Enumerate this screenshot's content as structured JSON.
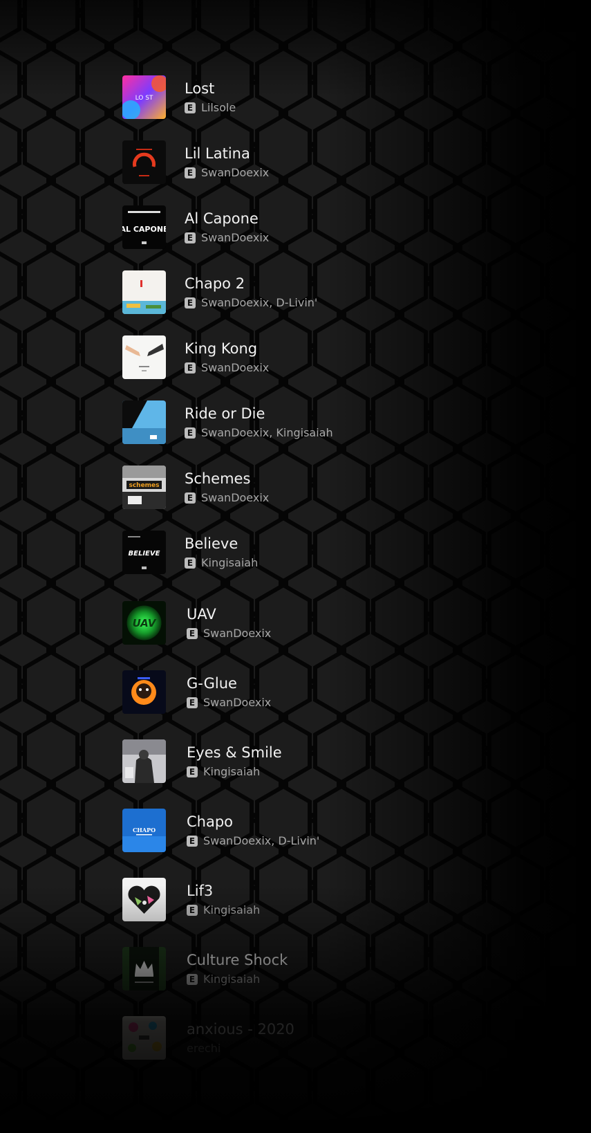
{
  "tracks": [
    {
      "title": "Lost",
      "explicit_label": "E",
      "artist": "Lilsole",
      "art_icon": "lost-album-art"
    },
    {
      "title": "Lil Latina",
      "explicit_label": "E",
      "artist": "SwanDoexix",
      "art_icon": "lil-latina-album-art"
    },
    {
      "title": "Al Capone",
      "explicit_label": "E",
      "artist": "SwanDoexix",
      "art_icon": "al-capone-album-art"
    },
    {
      "title": "Chapo 2",
      "explicit_label": "E",
      "artist": "SwanDoexix, D-Livin'",
      "art_icon": "chapo-2-album-art"
    },
    {
      "title": "King Kong",
      "explicit_label": "E",
      "artist": "SwanDoexix",
      "art_icon": "king-kong-album-art"
    },
    {
      "title": "Ride or Die",
      "explicit_label": "E",
      "artist": "SwanDoexix, Kingisaiah",
      "art_icon": "ride-or-die-album-art"
    },
    {
      "title": "Schemes",
      "explicit_label": "E",
      "artist": "SwanDoexix",
      "art_icon": "schemes-album-art"
    },
    {
      "title": "Believe",
      "explicit_label": "E",
      "artist": "Kingisaiah",
      "art_icon": "believe-album-art"
    },
    {
      "title": "UAV",
      "explicit_label": "E",
      "artist": "SwanDoexix",
      "art_icon": "uav-album-art"
    },
    {
      "title": "G-Glue",
      "explicit_label": "E",
      "artist": "SwanDoexix",
      "art_icon": "g-glue-album-art"
    },
    {
      "title": "Eyes & Smile",
      "explicit_label": "E",
      "artist": "Kingisaiah",
      "art_icon": "eyes-and-smile-album-art"
    },
    {
      "title": "Chapo",
      "explicit_label": "E",
      "artist": "SwanDoexix, D-Livin'",
      "art_icon": "chapo-album-art"
    },
    {
      "title": "Lif3",
      "explicit_label": "E",
      "artist": "Kingisaiah",
      "art_icon": "lif3-album-art"
    },
    {
      "title": "Culture Shock",
      "explicit_label": "E",
      "artist": "Kingisaiah",
      "art_icon": "culture-shock-album-art"
    },
    {
      "title": "anxious - 2020",
      "artist": "erechi",
      "art_icon": "anxious-album-art"
    }
  ],
  "album_art_text": {
    "lost": "LO ST",
    "al_capone": "AL CAPONE",
    "uav": "UAV",
    "schemes": "schemes",
    "believe": "BELIEVE",
    "chapo": "CHAPO"
  },
  "colors": {
    "background": "#111111",
    "title_text": "#f2f2f2",
    "artist_text": "#a8a8a8",
    "badge": "#bdbdbd"
  }
}
